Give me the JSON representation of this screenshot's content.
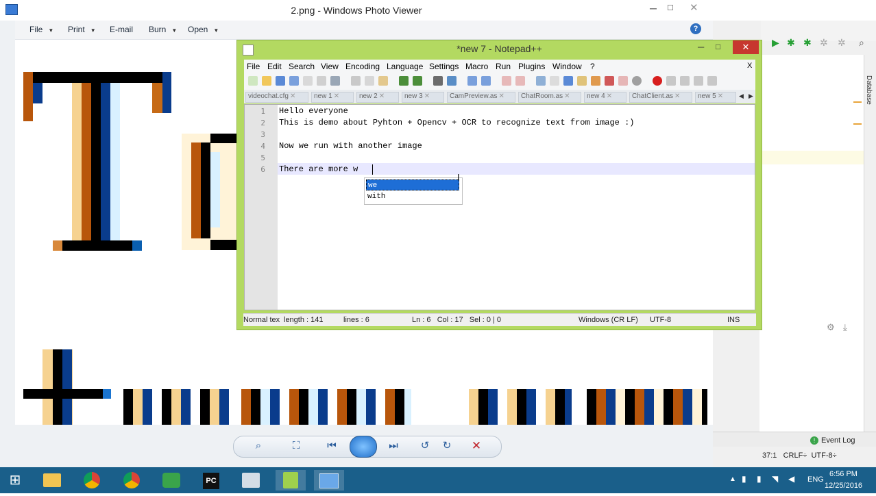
{
  "photo_viewer": {
    "title": "2.png - Windows Photo Viewer",
    "menu": [
      "File",
      "Print",
      "E-mail",
      "Burn",
      "Open"
    ],
    "help_icon": "help-icon"
  },
  "notepad": {
    "title": "*new 7 - Notepad++",
    "menu": [
      "File",
      "Edit",
      "Search",
      "View",
      "Encoding",
      "Language",
      "Settings",
      "Macro",
      "Run",
      "Plugins",
      "Window",
      "?"
    ],
    "close_doc": "X",
    "tabs": [
      "videochat.cfg",
      "new 1",
      "new 2",
      "new 3",
      "CamPreview.as",
      "ChatRoom.as",
      "new 4",
      "ChatClient.as",
      "new 5"
    ],
    "lines": [
      {
        "n": "1",
        "text": "Hello everyone"
      },
      {
        "n": "2",
        "text": "This is demo about Pyhton + Opencv + OCR to recognize text from image :)"
      },
      {
        "n": "3",
        "text": ""
      },
      {
        "n": "4",
        "text": "Now we run with another image"
      },
      {
        "n": "5",
        "text": ""
      },
      {
        "n": "6",
        "text": "There are more w"
      }
    ],
    "autocomplete": [
      "we",
      "with"
    ],
    "status": {
      "type": "Normal tex",
      "length": "length : 141",
      "lines": "lines : 6",
      "pos": "Ln : 6   Col : 17   Sel : 0 | 0",
      "eol": "Windows (CR LF)",
      "encoding": "UTF-8",
      "mode": "INS"
    }
  },
  "ide_panel": {
    "side_label": "Database",
    "event_log": "Event Log",
    "status": "37:1   CRLF÷  UTF-8÷"
  },
  "taskbar": {
    "time": "6:56 PM",
    "date": "12/25/2016",
    "lang": "ENG",
    "pinned": [
      "File Explorer",
      "Chrome",
      "Chrome",
      "Wi-Fi",
      "PyCharm",
      "App",
      "Notepad++",
      "Photo Viewer"
    ]
  },
  "colors": {
    "npp_frame": "#b3d961",
    "taskbar": "#1a5f8a",
    "selection": "#1e6ed6"
  }
}
